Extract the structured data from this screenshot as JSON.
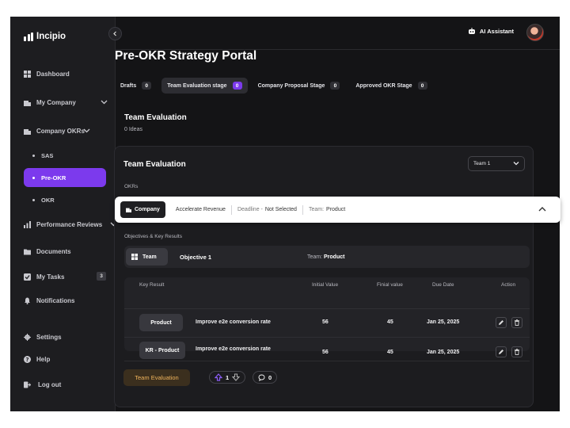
{
  "app": {
    "name": "Incipio"
  },
  "sidebar": {
    "items": {
      "dashboard": {
        "label": "Dashboard",
        "icon": "dashboard-icon"
      },
      "my_company": {
        "label": "My Company",
        "icon": "building-icon"
      },
      "company_okrs": {
        "label": "Company OKRs",
        "icon": "building-icon"
      },
      "sas": {
        "label": "SAS"
      },
      "pre_okr": {
        "label": "Pre-OKR"
      },
      "okr": {
        "label": "OKR"
      },
      "performance_reviews": {
        "label": "Performance Reviews",
        "icon": "bar-chart-icon"
      },
      "documents": {
        "label": "Documents",
        "icon": "folder-icon"
      },
      "my_tasks": {
        "label": "My Tasks",
        "icon": "tasks-icon",
        "badge": "3"
      },
      "notifications": {
        "label": "Notifications",
        "icon": "bell-icon"
      },
      "settings": {
        "label": "Settings",
        "icon": "gear-icon"
      },
      "help": {
        "label": "Help",
        "icon": "help-icon"
      },
      "logout": {
        "label": "Log out",
        "icon": "logout-icon"
      }
    }
  },
  "topbar": {
    "ai_assistant": "AI Assistant"
  },
  "page": {
    "title": "Pre-OKR Strategy Portal",
    "tabs": [
      {
        "label": "Drafts",
        "count": "0"
      },
      {
        "label": "Team Evaluation stage",
        "count": "0",
        "active": true
      },
      {
        "label": "Company Proposal Stage",
        "count": "0"
      },
      {
        "label": "Approved OKR Stage",
        "count": "0"
      }
    ],
    "section": {
      "title": "Team Evaluation",
      "subtitle": "0 Ideas"
    }
  },
  "card": {
    "title": "Team Evaluation",
    "team_select": "Team 1",
    "okrs_label": "OKRs",
    "okr_bar": {
      "chip": "Company",
      "name": "Accelerate Revenue",
      "deadline_label": "Deadline -",
      "deadline_value": "Not Selected",
      "team_label": "Team:",
      "team_value": "Product"
    },
    "objectives_label": "Objectives & Key Results",
    "objective": {
      "chip": "Team",
      "name": "Objective 1",
      "team_label": "Team:",
      "team_value": "Product"
    },
    "table": {
      "headers": {
        "key_result": "Key Result",
        "initial": "Initial Value",
        "final": "Finial value",
        "due": "Due Date",
        "action": "Action"
      },
      "rows": [
        {
          "chip": "Product",
          "name": "Improve e2e conversion rate",
          "initial": "56",
          "final": "45",
          "due": "Jan 25, 2025"
        },
        {
          "chip": "KR - Product",
          "name": "Improve e2e conversion rate",
          "initial": "56",
          "final": "45",
          "due": "Jan 25, 2025"
        }
      ]
    },
    "footer": {
      "stage_button": "Team Evaluation",
      "votes": "1",
      "comments": "0"
    }
  },
  "colors": {
    "accent": "#7c3aed",
    "background": "#141416",
    "sidebar": "#1d1d20",
    "stage_text": "#f0b45c"
  }
}
